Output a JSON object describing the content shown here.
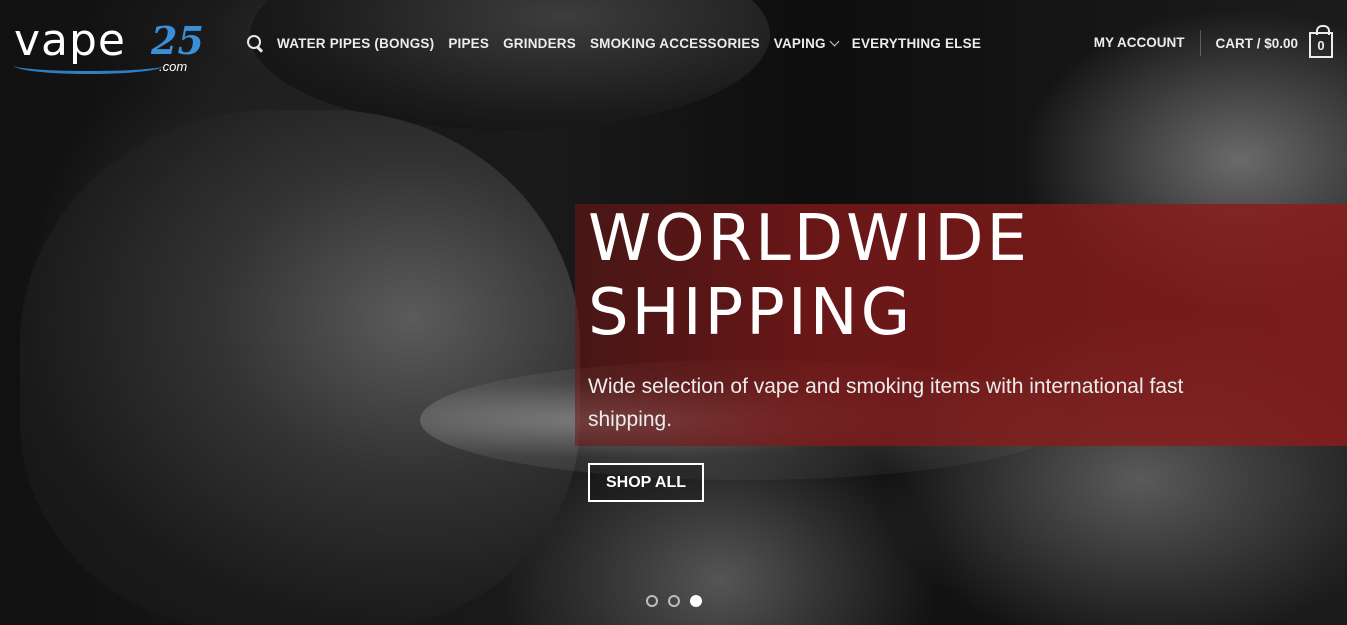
{
  "logo": {
    "main": "vape",
    "number": "25",
    "suffix": ".com"
  },
  "nav": {
    "search_icon": "search-icon",
    "items": [
      {
        "label": "WATER PIPES (BONGS)"
      },
      {
        "label": "PIPES"
      },
      {
        "label": "GRINDERS"
      },
      {
        "label": "SMOKING ACCESSORIES"
      },
      {
        "label": "VAPING",
        "has_dropdown": true
      },
      {
        "label": "EVERYTHING ELSE"
      }
    ]
  },
  "account": {
    "label": "MY ACCOUNT"
  },
  "cart": {
    "label": "CART / $0.00",
    "count": "0"
  },
  "hero": {
    "headline_line1": "WORLDWIDE",
    "headline_line2": "SHIPPING",
    "subtext": "Wide selection of vape and smoking items with international fast shipping.",
    "button_label": "SHOP ALL",
    "banner_color": "#8c1c1c",
    "slides": 3,
    "active_slide": 3
  }
}
